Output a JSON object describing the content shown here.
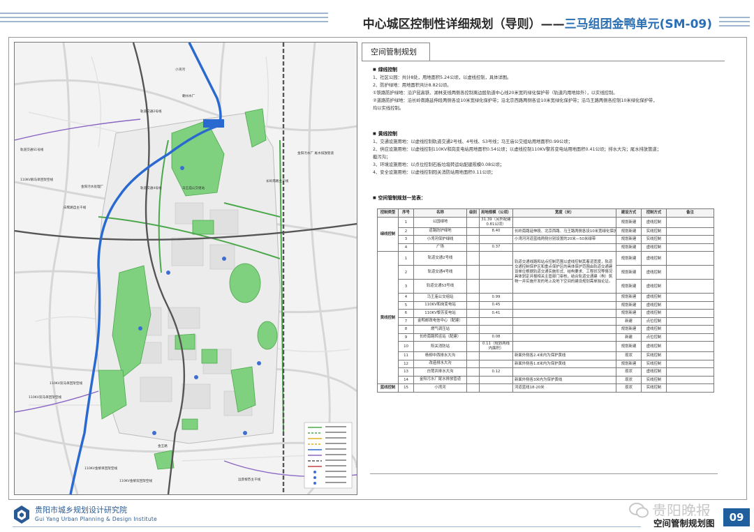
{
  "header": {
    "title_main": "中心城区控制性详细规划（导则）——",
    "title_unit": "三马组团金鸭单元(SM-09)"
  },
  "panel": {
    "tab": "空间管制规划",
    "green_heading": "绿线控制",
    "green": [
      "1、社区公园：共计8处，用地面积5.24公顷，以虚线控制，具体详图。",
      "2、防护绿地：用地面积共计8.82公顷。",
      "①铁路防护绿地：沿沪昆高铁、湖林支线两侧各控制离边股轨道中心线20米宽的绿化保护带（轨道内用地除外），以实线控制。",
      "②道路防护绿地：沿长岭南路延伸段两侧各设10米宽绿化保护带；沿北京西路两侧各设10米宽绿化保护带；沿马王路两侧各控制10米绿化保护带，",
      "均以实线控制。"
    ],
    "yellow_heading": "黄线控制",
    "yellow": [
      "1、交通设施用地：以虚线控制轨道交通2号线、4号线、S3号线；马王庙公交组站用地面积0.99公顷；",
      "2、供应设施用地：以虚线控制110KV和岗变电站用地面积0.54公顷；以虚线控制110KV黎苏变电站用地面积0.41公顷；排水大沟；尾水排放管道；",
      "截污沟；",
      "3、环境设施用地：以点位控制石板垃圾转运站配建规模0.08公顷；",
      "4、安全设施用地：以虚线控制阳关消防站用地面积0.11公顷；"
    ],
    "table_heading": "空间管制规划一览表：",
    "table": {
      "headers": [
        "控制类型",
        "序号",
        "名称",
        "级别",
        "用地规模（公顷）",
        "宽度（米）",
        "建设方式",
        "控制方式",
        "备注"
      ],
      "group_green": "绿线控制",
      "group_yellow": "黄线控制",
      "group_blue": "蓝线控制",
      "rows": [
        [
          "1",
          "公园绿地",
          "",
          "31.39（另外配建0.81公顷）",
          "",
          "规划新建",
          "虚线控制",
          ""
        ],
        [
          "2",
          "道路防护绿地",
          "",
          "8.40",
          "长岭南路延伸段、北京西路、马王路两侧各设10米宽绿化保护带",
          "规划新建",
          "实线控制",
          ""
        ],
        [
          "3",
          "小湾河保护绿线",
          "",
          "",
          "小湾河河道蓝线两侧分别设置的20米—50米绿带",
          "规划新建",
          "实线控制",
          ""
        ],
        [
          "4",
          "广场",
          "",
          "0.37",
          "",
          "规划新建",
          "虚线控制",
          ""
        ],
        [
          "1",
          "轨道交通2号线",
          "",
          "",
          "",
          "规划新建",
          "虚线控制",
          ""
        ],
        [
          "2",
          "轨道交通4号线",
          "",
          "",
          "",
          "规划新建",
          "虚线控制",
          ""
        ],
        [
          "3",
          "轨道交通S3号线",
          "",
          "",
          "",
          "规划新建",
          "虚线控制",
          ""
        ],
        [
          "4",
          "马王庙公交组站",
          "",
          "0.99",
          "",
          "规划新建",
          "虚线控制",
          ""
        ],
        [
          "5",
          "110KV和岗变电站",
          "",
          "0.45",
          "",
          "规划新建",
          "虚线控制",
          ""
        ],
        [
          "6",
          "110KV黎苏变电站",
          "",
          "0.41",
          "",
          "规划新建",
          "虚线控制",
          ""
        ],
        [
          "7",
          "金鸭邮政电信中心（配建）",
          "",
          "",
          "",
          "新建",
          "点位控制",
          ""
        ],
        [
          "8",
          "燃气调压站",
          "",
          "",
          "",
          "规划新建",
          "虚线控制",
          ""
        ],
        [
          "9",
          "长岭南路转运站（配建）",
          "",
          "0.08",
          "",
          "新建",
          "点位控制",
          ""
        ],
        [
          "10",
          "阳关消防站",
          "",
          "0.11（规划两线内面积）",
          "",
          "规划新建",
          "虚线控制",
          ""
        ],
        [
          "11",
          "杨柳中西排水大沟",
          "",
          "",
          "新面外侧各2.4米内为保护黄线",
          "现状",
          "实线控制",
          ""
        ],
        [
          "12",
          "改造排水大沟",
          "",
          "",
          "新面外侧各1.8米内为保护黄线",
          "规划新建",
          "实线控制",
          ""
        ],
        [
          "13",
          "白鹭井排水大沟",
          "",
          "0.12",
          "",
          "现状",
          "虚线控制",
          ""
        ],
        [
          "14",
          "金阳污水厂尾水排放管道",
          "",
          "",
          "新面外侧各3米内为保护黄线",
          "现状",
          "实线控制",
          ""
        ],
        [
          "15",
          "小湾河",
          "",
          "",
          "河道蓝线18-20米",
          "现状",
          "实线控制",
          ""
        ]
      ],
      "rail_note": "轨道交通线路和站点控制范围以虚线控制其着道宽度，轨道交通控制保护区和重点保护区的具体保护范围由轨道交通建设单位根据轨道交通实施形式、结构要求、工程状况等情况具体划定并报相关主管部门审核，结合轨道交通建（构）筑物一并实施开发的地上及地下空间的建设规划需单独论证。"
    }
  },
  "map_labels": {
    "rail2": "轨道交通2号线",
    "rail_s1": "轨道交通S1号线",
    "rail4": "轨道交通4号线",
    "line1": "110KV鹅马单回架空线",
    "wwtp": "金阳污水厂\n尾水排放管道",
    "xiaowan": "小湾河",
    "baihu": "白鹭路自主干线",
    "jinyang": "金阳污水处理厂",
    "changling": "长岭南路主干线",
    "maoling": "马王庙公交组站",
    "line2": "110KV双马单回架空线",
    "line3": "110KV双马单回架空线",
    "line4": "110KV金黎单回架空线",
    "line5": "110KV金黎双回架空线",
    "line6": "远景黎苏主干线",
    "jinbai": "金王路",
    "zhang": "朝州水厂"
  },
  "footer": {
    "org_cn": "贵阳市城乡规划设计研究院",
    "org_en": "Gui Yang Urban Planning & Design Institute",
    "watermark": "贵阳晚报",
    "drawing_title": "空间管制规划图",
    "page": "09"
  },
  "colors": {
    "accent_blue": "#1f5f9e",
    "green_park": "#7fd07f",
    "river": "#2a6ad0"
  }
}
